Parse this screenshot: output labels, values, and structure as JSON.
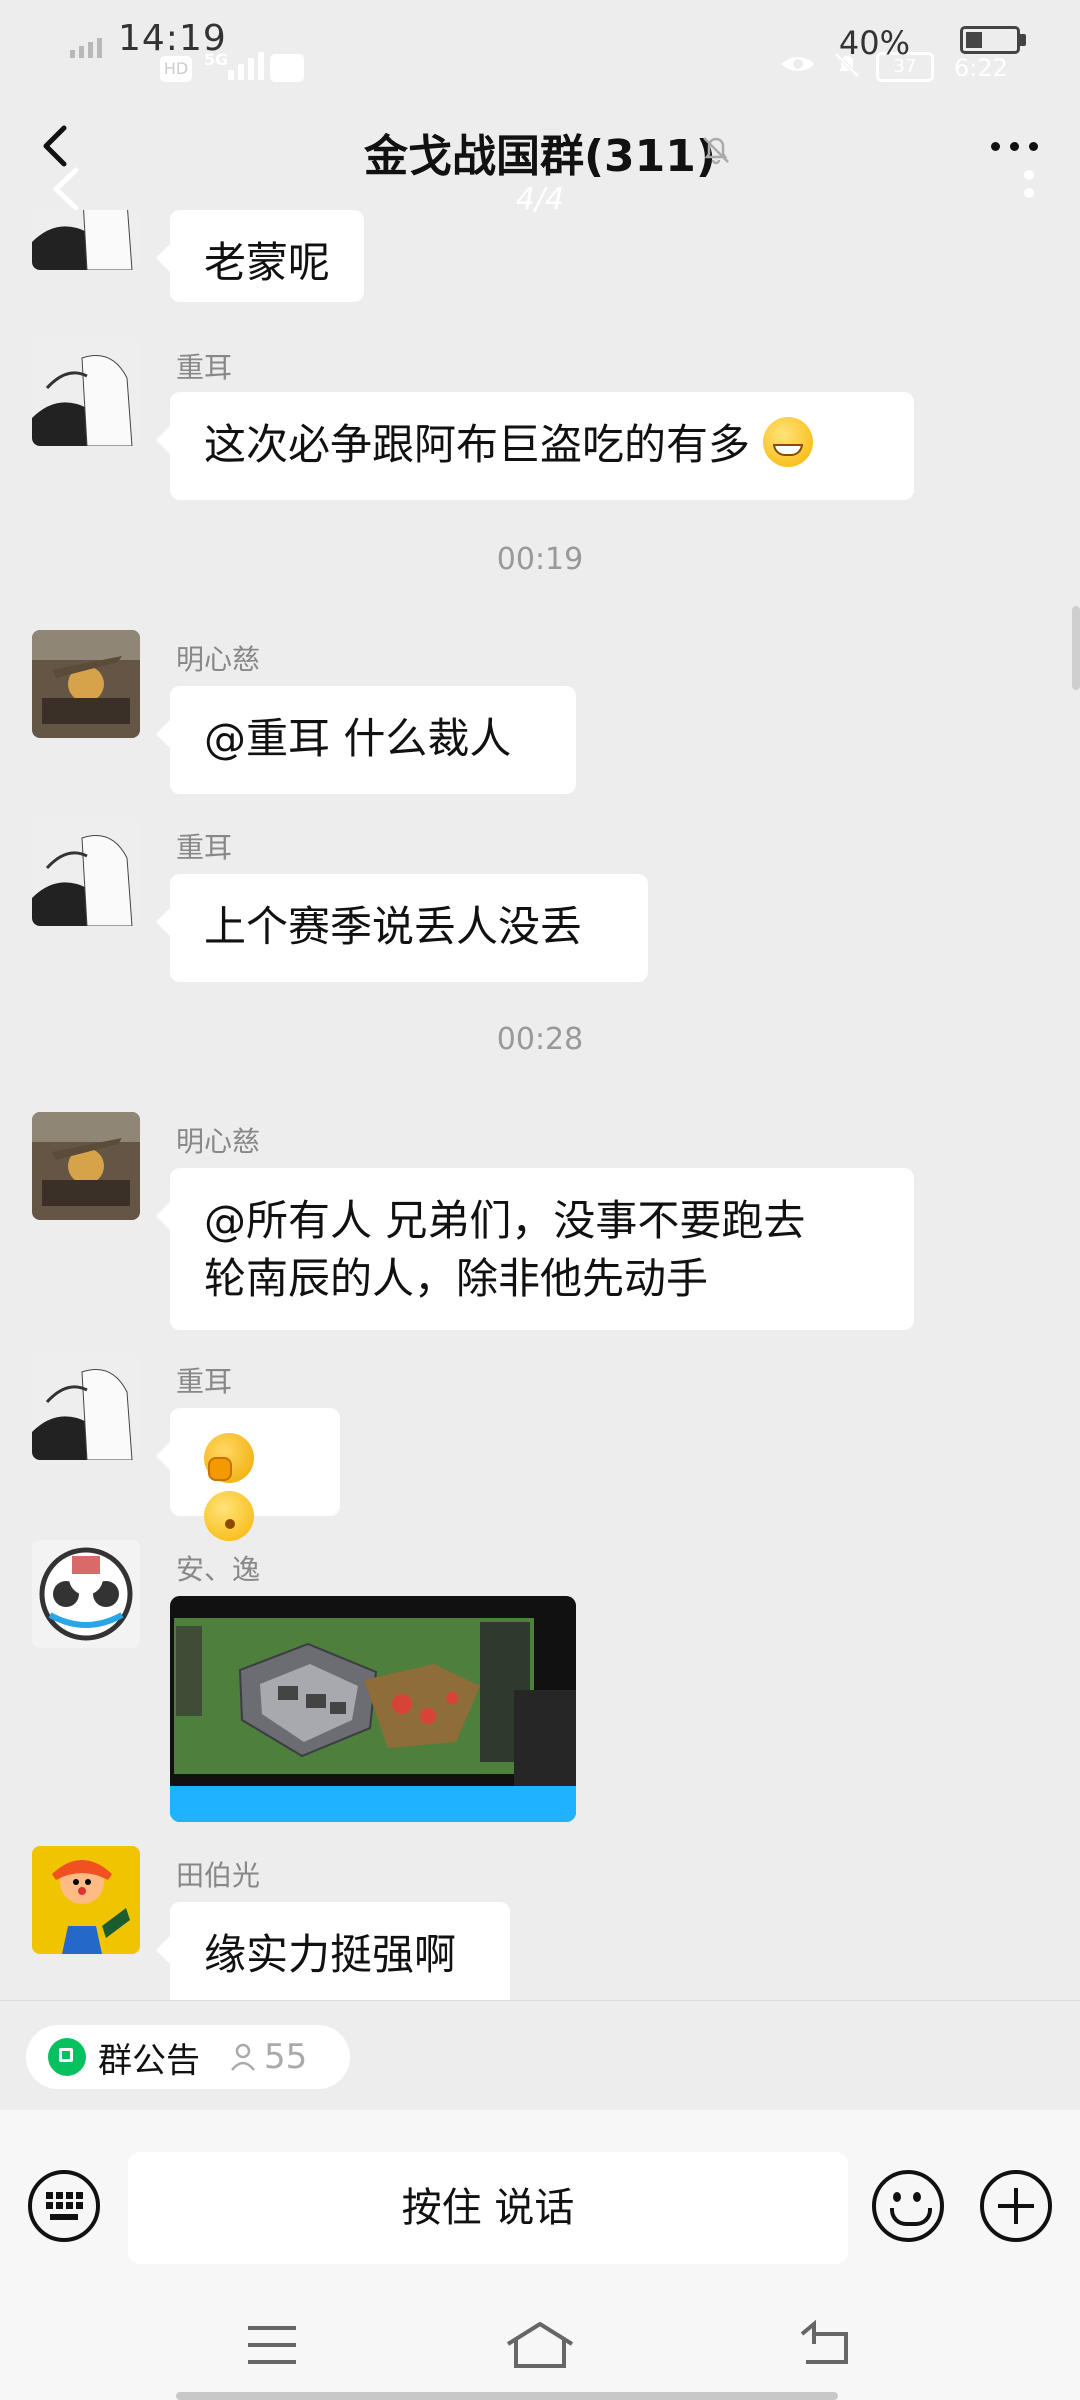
{
  "status_bar": {
    "time": "14:19",
    "hd_label": "HD",
    "network_label": "5G",
    "battery_percent": "40%",
    "battery_badge": "37",
    "secondary_time": "6:22"
  },
  "header": {
    "title": "金戈战国群(311)",
    "page_indicator": "4/4"
  },
  "messages": [
    {
      "sender": "",
      "text": "老蒙呢"
    },
    {
      "sender": "重耳",
      "text": "这次必争跟阿布巨盗吃的有多"
    },
    {
      "timestamp": "00:19"
    },
    {
      "sender": "明心慈",
      "text": "@重耳  什么裁人"
    },
    {
      "sender": "重耳",
      "text": "上个赛季说丢人没丢"
    },
    {
      "timestamp": "00:28"
    },
    {
      "sender": "明心慈",
      "text_line1": "@所有人  兄弟们，没事不要跑去",
      "text_line2": "轮南辰的人，除非他先动手"
    },
    {
      "sender": "重耳",
      "text": ""
    },
    {
      "sender": "安、逸",
      "text": ""
    },
    {
      "sender": "田伯光",
      "text": "缘实力挺强啊"
    }
  ],
  "bottom": {
    "announcement_label": "群公告",
    "member_count": "55",
    "voice_button_label": "按住 说话"
  },
  "colors": {
    "background": "#ededed",
    "bubble": "#ffffff",
    "accent_green": "#07c160"
  },
  "icons": {
    "back": "chevron-left-icon",
    "mute": "bell-off-icon",
    "more": "more-horizontal-icon",
    "keyboard": "keyboard-icon",
    "emoji": "emoji-icon",
    "plus": "plus-circle-icon",
    "home": "home-icon",
    "menu": "menu-icon",
    "nav_back": "back-icon"
  }
}
